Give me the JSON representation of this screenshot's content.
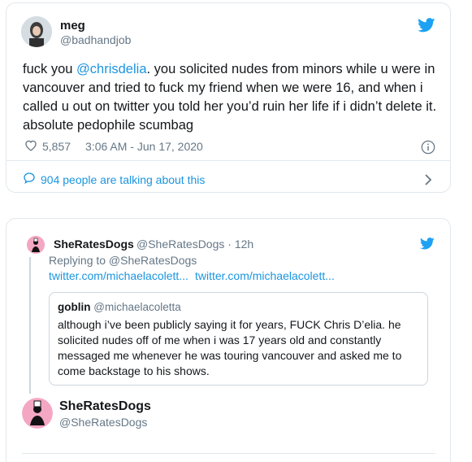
{
  "colors": {
    "link": "#1b95e0",
    "twitter_blue": "#1da1f2",
    "muted": "#657786",
    "border": "#e1e8ed"
  },
  "tweet1": {
    "display_name": "meg",
    "handle": "@badhandjob",
    "text_before": "fuck you ",
    "mention": "@chrisdelia",
    "text_after": ". you solicited nudes from minors while u were in vancouver and tried to fuck my friend when we were 16, and when i called u out on twitter you told her you’d ruin her life if i didn’t delete it. absolute pedophile scumbag",
    "likes": "5,857",
    "timestamp": "3:06 AM - Jun 17, 2020",
    "talking": "904 people are talking about this",
    "icons": [
      "heart-icon",
      "info-icon",
      "comment-icon",
      "chevron-right-icon",
      "twitter-bird-icon"
    ]
  },
  "tweet2": {
    "display_name": "SheRatesDogs",
    "handle": "@SheRatesDogs",
    "time": "· 12h",
    "replying": "Replying to @SheRatesDogs",
    "link1": "twitter.com/michaelacolett...",
    "link2": "twitter.com/michaelacolett...",
    "quote": {
      "display_name": "goblin",
      "handle": "@michaelacoletta",
      "text": "although i’ve been publicly saying it for years, FUCK Chris D’elia. he solicited nudes off of me when i was 17 years old and constantly messaged me whenever he was touring vancouver and asked me to come backstage to his shows."
    }
  },
  "tweet3": {
    "display_name": "SheRatesDogs",
    "handle": "@SheRatesDogs"
  }
}
